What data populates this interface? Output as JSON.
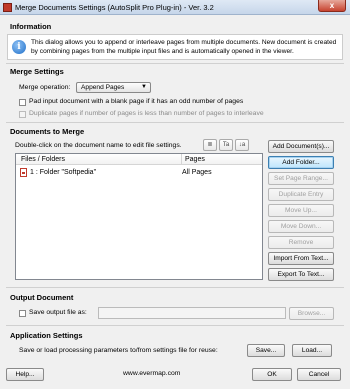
{
  "window": {
    "title": "Merge Documents Settings (AutoSplit Pro Plug-in) - Ver. 3.2",
    "close_glyph": "x"
  },
  "information": {
    "heading": "Information",
    "icon": "info-icon",
    "text": "This dialog allows you to append or interleave pages from multiple documents. New document is created by combining pages from the multiple input files and is automatically opened in the viewer."
  },
  "merge_settings": {
    "heading": "Merge Settings",
    "operation_label": "Merge operation:",
    "operation_value": "Append Pages",
    "pad_label": "Pad input document with a blank page if it has an odd number of pages",
    "pad_checked": false,
    "duplicate_label": "Duplicate pages if number of pages is less than number of pages to interleave",
    "duplicate_checked": false,
    "duplicate_enabled": false
  },
  "documents": {
    "heading": "Documents to Merge",
    "hint": "Double-click on the document name to edit file settings.",
    "tool_buttons": [
      "list-icon",
      "Ta",
      "↓a"
    ],
    "columns": [
      "Files / Folders",
      "Pages"
    ],
    "rows": [
      {
        "name": "1 : Folder \"Softpedia\"",
        "pages": "All Pages",
        "icon": "pdf-icon"
      }
    ],
    "buttons": {
      "add_documents": "Add Document(s)...",
      "add_folder": "Add Folder...",
      "set_page_range": "Set Page Range...",
      "duplicate_entry": "Duplicate Entry",
      "move_up": "Move Up...",
      "move_down": "Move Down...",
      "remove": "Remove",
      "import_text": "Import From Text...",
      "export_text": "Export To Text..."
    }
  },
  "output": {
    "heading": "Output Document",
    "save_label": "Save output file as:",
    "save_checked": false,
    "path_value": "",
    "browse": "Browse..."
  },
  "application": {
    "heading": "Application Settings",
    "hint": "Save or load processing parameters to/from settings file for reuse:",
    "save": "Save...",
    "load": "Load..."
  },
  "footer": {
    "help": "Help...",
    "website": "www.evermap.com",
    "ok": "OK",
    "cancel": "Cancel"
  },
  "colors": {
    "title_gradient_top": "#dfe9f5",
    "close_red": "#c7432f",
    "info_blue": "#1f6fc9",
    "focus_blue": "#3c7fb1"
  }
}
